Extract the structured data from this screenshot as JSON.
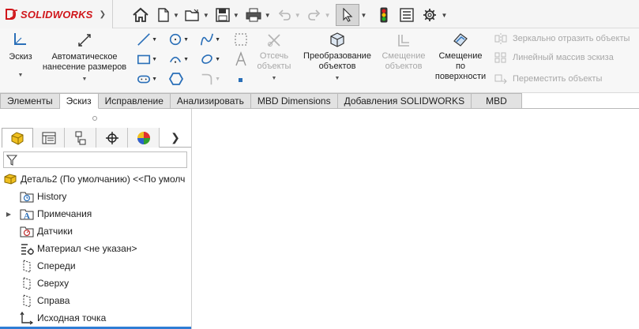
{
  "app": {
    "logo_text": "SOLIDWORKS",
    "logo_icon": "ds-logo-icon",
    "brand_color": "#d0161b",
    "accent_color": "#2f7dd4"
  },
  "quick_access": [
    "home-icon",
    "new-document-icon",
    "open-folder-icon",
    "save-icon",
    "print-icon",
    "undo-icon",
    "redo-icon",
    "select-pointer-icon",
    "rebuild-traffic-light-icon",
    "file-properties-icon",
    "options-gear-icon"
  ],
  "ribbon": {
    "sketch": {
      "label": "Эскиз",
      "icon": "sketch-icon"
    },
    "auto_dim": {
      "label_line1": "Автоматическое",
      "label_line2": "нанесение размеров",
      "icon": "smart-dimension-icon"
    },
    "trim": {
      "label_line1": "Отсечь",
      "label_line2": "объекты",
      "icon": "trim-entities-icon"
    },
    "convert": {
      "label_line1": "Преобразование",
      "label_line2": "объектов",
      "icon": "convert-entities-icon"
    },
    "offset": {
      "label_line1": "Смещение",
      "label_line2": "объектов",
      "icon": "offset-entities-icon"
    },
    "offset_surface": {
      "label_line1": "Смещение",
      "label_line2": "по",
      "label_line3": "поверхности",
      "icon": "offset-on-surface-icon"
    },
    "mirror": {
      "label": "Зеркально отразить объекты",
      "icon": "mirror-entities-icon"
    },
    "linear_pattern": {
      "label": "Линейный массив эскиза",
      "icon": "linear-pattern-icon"
    },
    "move": {
      "label": "Переместить объекты",
      "icon": "move-entities-icon"
    }
  },
  "tabs": [
    "Элементы",
    "Эскиз",
    "Исправление",
    "Анализировать",
    "MBD Dimensions",
    "Добавления SOLIDWORKS",
    "MBD"
  ],
  "active_tab": "Эскиз",
  "panel_tabs": [
    "feature-manager-icon",
    "property-manager-icon",
    "configuration-manager-icon",
    "dimxpert-manager-icon",
    "display-manager-icon"
  ],
  "tree": {
    "root": "Деталь2 (По умолчанию) <<По умолч",
    "items": [
      {
        "label": "History",
        "icon": "history-folder-icon",
        "expandable": false
      },
      {
        "label": "Примечания",
        "icon": "annotations-icon",
        "expandable": true
      },
      {
        "label": "Датчики",
        "icon": "sensors-folder-icon",
        "expandable": false
      },
      {
        "label": "Материал <не указан>",
        "icon": "material-icon",
        "expandable": false
      },
      {
        "label": "Спереди",
        "icon": "plane-icon",
        "expandable": false
      },
      {
        "label": "Сверху",
        "icon": "plane-icon",
        "expandable": false
      },
      {
        "label": "Справа",
        "icon": "plane-icon",
        "expandable": false
      },
      {
        "label": "Исходная точка",
        "icon": "origin-icon",
        "expandable": false
      }
    ]
  }
}
